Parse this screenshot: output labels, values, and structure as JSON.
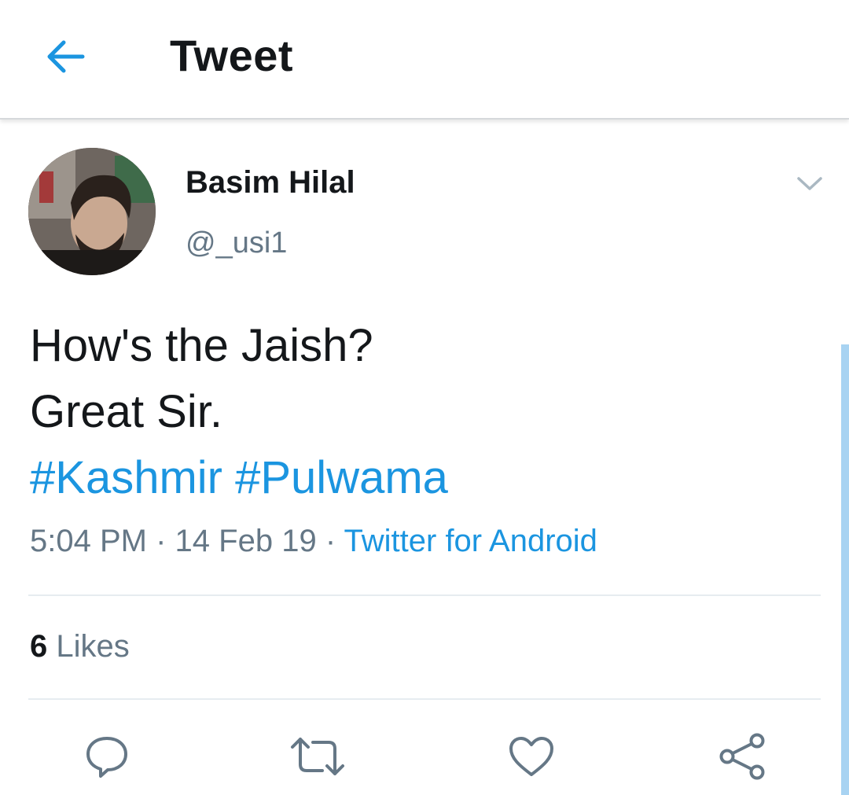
{
  "header": {
    "title": "Tweet",
    "back_icon": "arrow-left-icon"
  },
  "author": {
    "display_name": "Basim Hilal",
    "handle": "@_usi1"
  },
  "tweet": {
    "lines": [
      "How's the Jaish?",
      "Great Sir."
    ],
    "hashtags": [
      "#Kashmir",
      "#Pulwama"
    ],
    "time": "5:04 PM",
    "separator": "·",
    "date": "14 Feb 19",
    "source": "Twitter for Android"
  },
  "engagement": {
    "likes_count": "6",
    "likes_label": "Likes"
  },
  "actions": [
    "reply-icon",
    "retweet-icon",
    "like-icon",
    "share-icon"
  ],
  "colors": {
    "accent": "#1b95e0",
    "text": "#14171a",
    "secondary": "#657786",
    "divider": "#e6ecf0"
  }
}
